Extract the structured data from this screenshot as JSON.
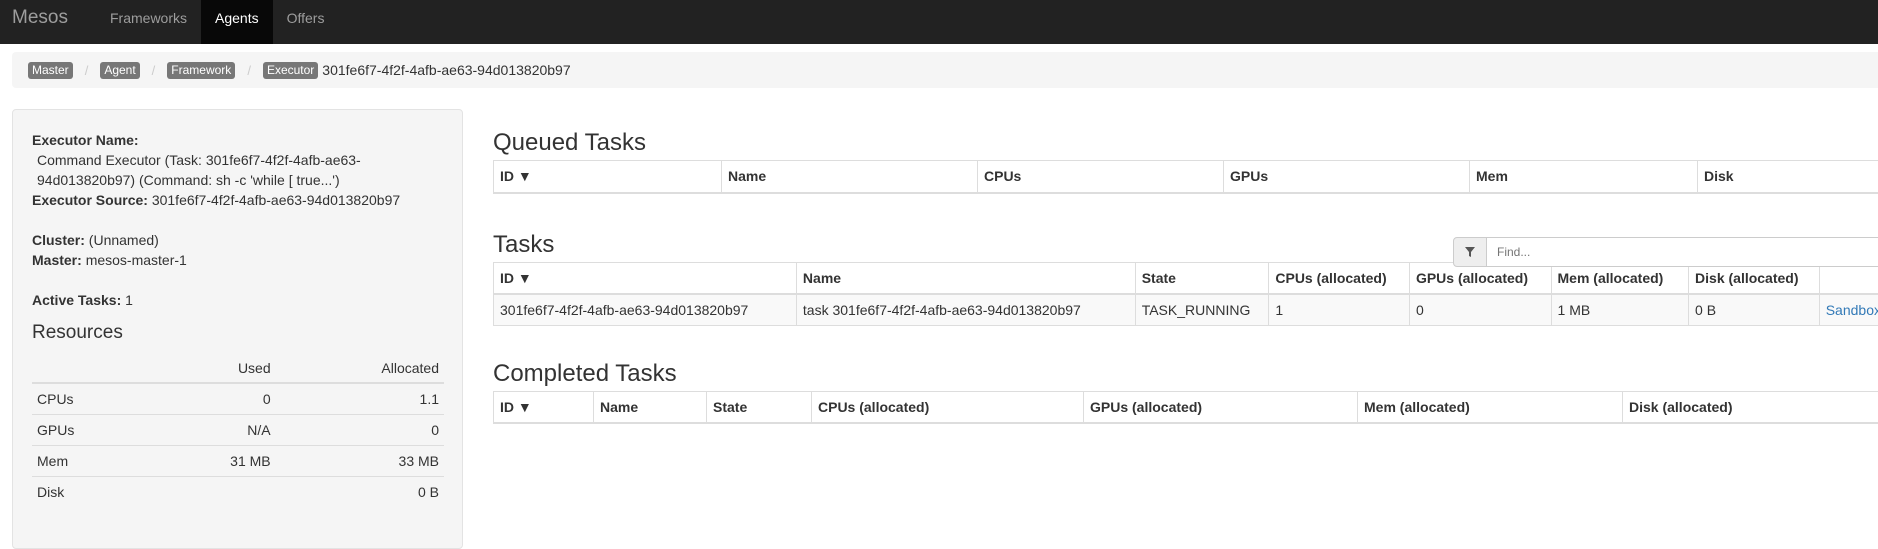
{
  "navbar": {
    "brand": "Mesos",
    "items": [
      {
        "label": "Frameworks"
      },
      {
        "label": "Agents",
        "active": true
      },
      {
        "label": "Offers"
      }
    ]
  },
  "breadcrumb": {
    "items": [
      "Master",
      "Agent",
      "Framework",
      "Executor"
    ],
    "current": "301fe6f7-4f2f-4afb-ae63-94d013820b97"
  },
  "executor": {
    "name_label": "Executor Name:",
    "name_value_line1": "Command Executor (Task: 301fe6f7-4f2f-4afb-ae63-",
    "name_value_line2": "94d013820b97) (Command: sh -c 'while [ true...')",
    "source_label": "Executor Source:",
    "source_value": "301fe6f7-4f2f-4afb-ae63-94d013820b97",
    "cluster_label": "Cluster:",
    "cluster_value": "(Unnamed)",
    "master_label": "Master:",
    "master_value": "mesos-master-1",
    "active_tasks_label": "Active Tasks:",
    "active_tasks_value": "1"
  },
  "resources": {
    "title": "Resources",
    "headers": [
      "",
      "Used",
      "Allocated"
    ],
    "rows": [
      [
        "CPUs",
        "0",
        "1.1"
      ],
      [
        "GPUs",
        "N/A",
        "0"
      ],
      [
        "Mem",
        "31 MB",
        "33 MB"
      ],
      [
        "Disk",
        "",
        "0 B"
      ]
    ]
  },
  "queued": {
    "title": "Queued Tasks",
    "headers": [
      "ID ▼",
      "Name",
      "CPUs",
      "GPUs",
      "Mem",
      "Disk"
    ]
  },
  "tasks": {
    "title": "Tasks",
    "find_placeholder": "Find...",
    "headers": [
      "ID ▼",
      "Name",
      "State",
      "CPUs (allocated)",
      "GPUs (allocated)",
      "Mem (allocated)",
      "Disk (allocated)",
      ""
    ],
    "rows": [
      [
        "301fe6f7-4f2f-4afb-ae63-94d013820b97",
        "task 301fe6f7-4f2f-4afb-ae63-94d013820b97",
        "TASK_RUNNING",
        "1",
        "0",
        "1 MB",
        "0 B",
        "Sandbox"
      ]
    ]
  },
  "completed": {
    "title": "Completed Tasks",
    "headers": [
      "ID ▼",
      "Name",
      "State",
      "CPUs (allocated)",
      "GPUs (allocated)",
      "Mem (allocated)",
      "Disk (allocated)"
    ]
  },
  "colors": {
    "navbar": "#222222",
    "link": "#337ab7",
    "label": "#777777"
  }
}
